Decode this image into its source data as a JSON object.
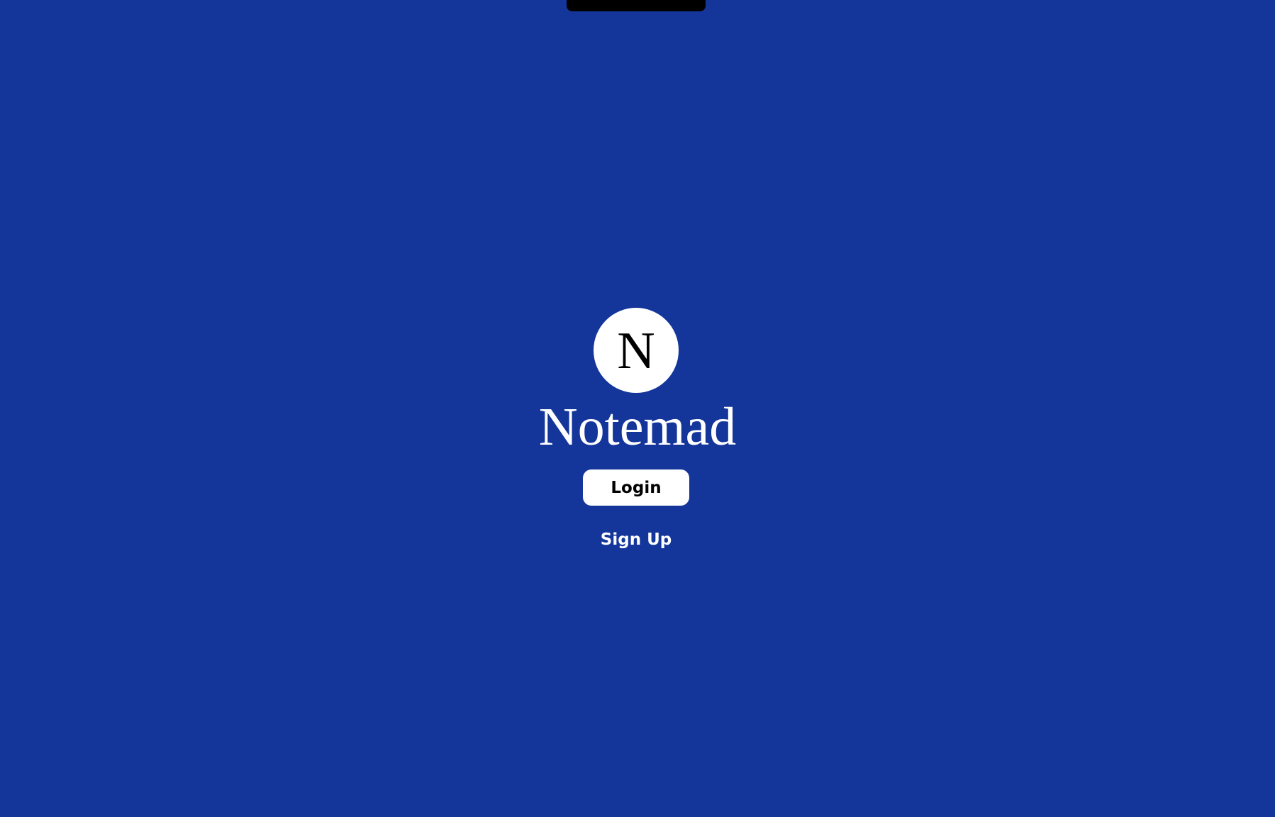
{
  "app": {
    "logo_letter": "N",
    "title": "Notemad"
  },
  "actions": {
    "login_label": "Login",
    "signup_label": "Sign Up"
  },
  "colors": {
    "background": "#14369a",
    "notch": "#000000",
    "button": "#ffffff",
    "text_on_button": "#000000",
    "text_on_background": "#ffffff"
  }
}
